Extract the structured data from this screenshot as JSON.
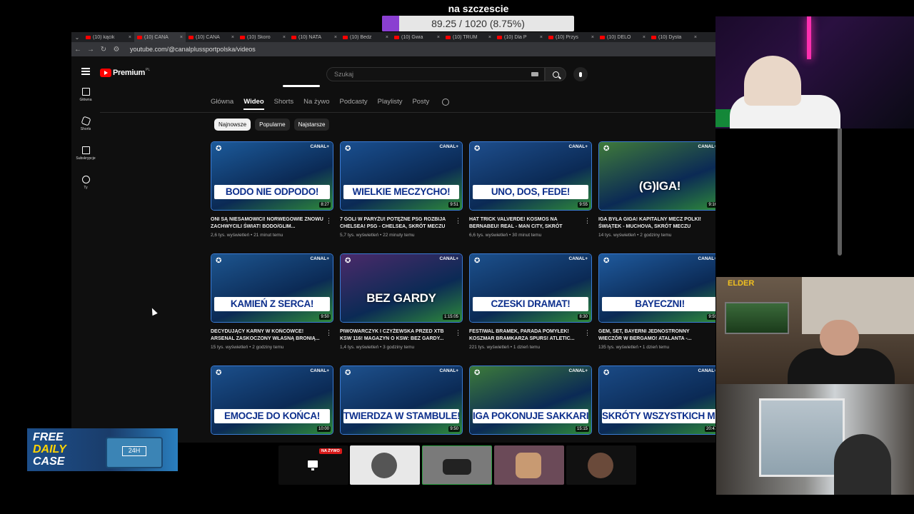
{
  "goal": {
    "title": "na szczescie",
    "progress_text": "89.25 / 1020 (8.75%)",
    "progress_fraction": 0.0875,
    "fill_color": "#8a3fd1"
  },
  "browser": {
    "tabs": [
      {
        "label": "(10) kącik"
      },
      {
        "label": "(10) CANA"
      },
      {
        "label": "(10) CANA"
      },
      {
        "label": "(10) Skoro"
      },
      {
        "label": "(10) NATA"
      },
      {
        "label": "(10) Bedz"
      },
      {
        "label": "(10) Gwia"
      },
      {
        "label": "(10) TRUM"
      },
      {
        "label": "(10) Dla P"
      },
      {
        "label": "(10) Przys"
      },
      {
        "label": "(10) DELO"
      },
      {
        "label": "(10) Dysta"
      }
    ],
    "url": "youtube.com/@canalplussportpolska/videos"
  },
  "youtube": {
    "logo_text": "Premium",
    "logo_region": "PL",
    "search_placeholder": "Szukaj",
    "sidebar": [
      {
        "label": "Główna",
        "icon": "home-icon"
      },
      {
        "label": "Shorts",
        "icon": "shorts-icon"
      },
      {
        "label": "Subskrypcje",
        "icon": "subscriptions-icon"
      },
      {
        "label": "Ty",
        "icon": "you-icon"
      }
    ],
    "channel_tabs": [
      "Główna",
      "Wideo",
      "Shorts",
      "Na żywo",
      "Podcasty",
      "Playlisty",
      "Posty"
    ],
    "active_tab": "Wideo",
    "chips": [
      "Najnowsze",
      "Popularne",
      "Najstarsze"
    ],
    "active_chip": "Najnowsze",
    "videos": [
      {
        "headline": "BODO NIE ODPODO!",
        "duration": "8:27",
        "title": "ONI SĄ NIESAMOWICI! NORWEGOWIE ZNOWU ZACHWYCILI ŚWIAT! BODO/GLIM...",
        "meta": "2,6 tys. wyświetleń • 21 minut temu",
        "bg": "#1c5a9a",
        "brand": "CANAL+"
      },
      {
        "headline": "WIELKIE MECZYCHO!",
        "duration": "9:51",
        "title": "7 GOLI W PARYŻU! POTĘŻNE PSG ROZBIJA CHELSEA! PSG - CHELSEA, SKRÓT MECZU",
        "meta": "5,7 tys. wyświetleń • 22 minuty temu",
        "bg": "#1a4f8f",
        "brand": "CANAL+"
      },
      {
        "headline": "UNO, DOS, FEDE!",
        "duration": "9:55",
        "title": "HAT TRICK VALVERDE! KOSMOS NA BERNABEU! REAL - MAN CITY, SKRÓT",
        "meta": "6,6 tys. wyświetleń • 30 minut temu",
        "bg": "#1e4e8c",
        "brand": "CANAL+"
      },
      {
        "headline": "(G)IGA!",
        "duration": "9:16",
        "title": "IGA BYŁA GIGA! KAPITALNY MECZ POLKI! ŚWIĄTEK - MUCHOVA, SKRÓT MECZU",
        "meta": "14 tys. wyświetleń • 2 godziny temu",
        "bg": "#3f7a3a",
        "brand": "CANAL+"
      },
      {
        "headline": "KAMIEŃ Z SERCA!",
        "duration": "9:50",
        "title": "DECYDUJĄCY KARNY W KOŃCÓWCE! ARSENAL ZASKOCZONY WŁASNĄ BRONIĄ...",
        "meta": "15 tys. wyświetleń • 2 godziny temu",
        "bg": "#1d558f",
        "brand": "CANAL+"
      },
      {
        "headline": "BEZ GARDY",
        "duration": "1:15:05",
        "title": "PIWOWARCZYK I CZYŻEWSKA PRZED XTB KSW 116! MAGAZYN O KSW: BEZ GARDY...",
        "meta": "1,4 tys. wyświetleń • 3 godziny temu",
        "bg": "#4b2a6a",
        "brand": "CANAL+"
      },
      {
        "headline": "CZESKI DRAMAT!",
        "duration": "8:30",
        "title": "FESTIWAL BRAMEK, PARADA POMYŁEK! KOSZMAR BRAMKARZA SPURS! ATLETIC...",
        "meta": "221 tys. wyświetleń • 1 dzień temu",
        "bg": "#1c508c",
        "brand": "CANAL+"
      },
      {
        "headline": "BAYECZNI!",
        "duration": "9:59",
        "title": "GEM, SET, BAYERNI JEDNOSTRONNY WIECZÓR W BERGAMO! ATALANTA -...",
        "meta": "135 tys. wyświetleń • 1 dzień temu",
        "bg": "#1f5a9d",
        "brand": "CANAL+"
      },
      {
        "headline": "EMOCJE DO KOŃCA!",
        "duration": "10:00",
        "title": "",
        "meta": "",
        "bg": "#1b4f8b",
        "brand": "CANAL+"
      },
      {
        "headline": "TWIERDZA W STAMBULE!",
        "duration": "9:50",
        "title": "",
        "meta": "",
        "bg": "#1e518d",
        "brand": "CANAL+"
      },
      {
        "headline": "IGA POKONUJE SAKKARI!",
        "duration": "15:15",
        "title": "",
        "meta": "",
        "bg": "#3c7a3a",
        "brand": "CANAL+"
      },
      {
        "headline": "SKRÓTY WSZYSTKICH MECZÓW",
        "duration": "20:47",
        "title": "",
        "meta": "",
        "bg": "#1a4a85",
        "brand": "CANAL+"
      }
    ]
  },
  "overlay": {
    "promo": {
      "line1": "FREE",
      "line2": "DAILY",
      "line3": "CASE",
      "box_label": "24H"
    },
    "cam_tag": "ELDER",
    "live_badge": "NA ŻYWO"
  }
}
